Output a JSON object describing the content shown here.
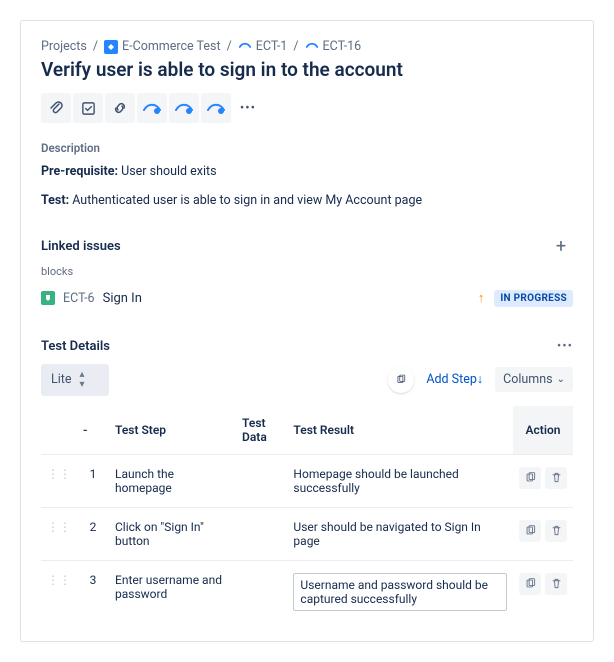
{
  "breadcrumb": {
    "root": "Projects",
    "project": "E-Commerce Test",
    "parent_key": "ECT-1",
    "key": "ECT-16"
  },
  "summary": "Verify user is able to sign in to the account",
  "description": {
    "heading": "Description",
    "prereq_label": "Pre-requisite:",
    "prereq_text": "User should exits",
    "test_label": "Test:",
    "test_text": "Authenticated user is able to sign in and view My Account page"
  },
  "linked": {
    "heading": "Linked issues",
    "relationship": "blocks",
    "issue_key": "ECT-6",
    "issue_title": "Sign In",
    "status": "IN PROGRESS"
  },
  "test_details": {
    "heading": "Test Details",
    "view_mode": "Lite",
    "add_step_label": "Add Step↓",
    "columns_label": "Columns",
    "cols": {
      "order": "-",
      "step": "Test Step",
      "data": "Test Data",
      "result": "Test Result",
      "action": "Action"
    },
    "rows": [
      {
        "n": "1",
        "step": "Launch the homepage",
        "data": "",
        "result": "Homepage should be launched successfully",
        "hl": false
      },
      {
        "n": "2",
        "step": "Click on \"Sign In\" button",
        "data": "",
        "result": "User should be navigated to Sign In page",
        "hl": false
      },
      {
        "n": "3",
        "step": "Enter username and password",
        "data": "",
        "result": "Username and password should be captured successfully",
        "hl": true
      }
    ]
  }
}
